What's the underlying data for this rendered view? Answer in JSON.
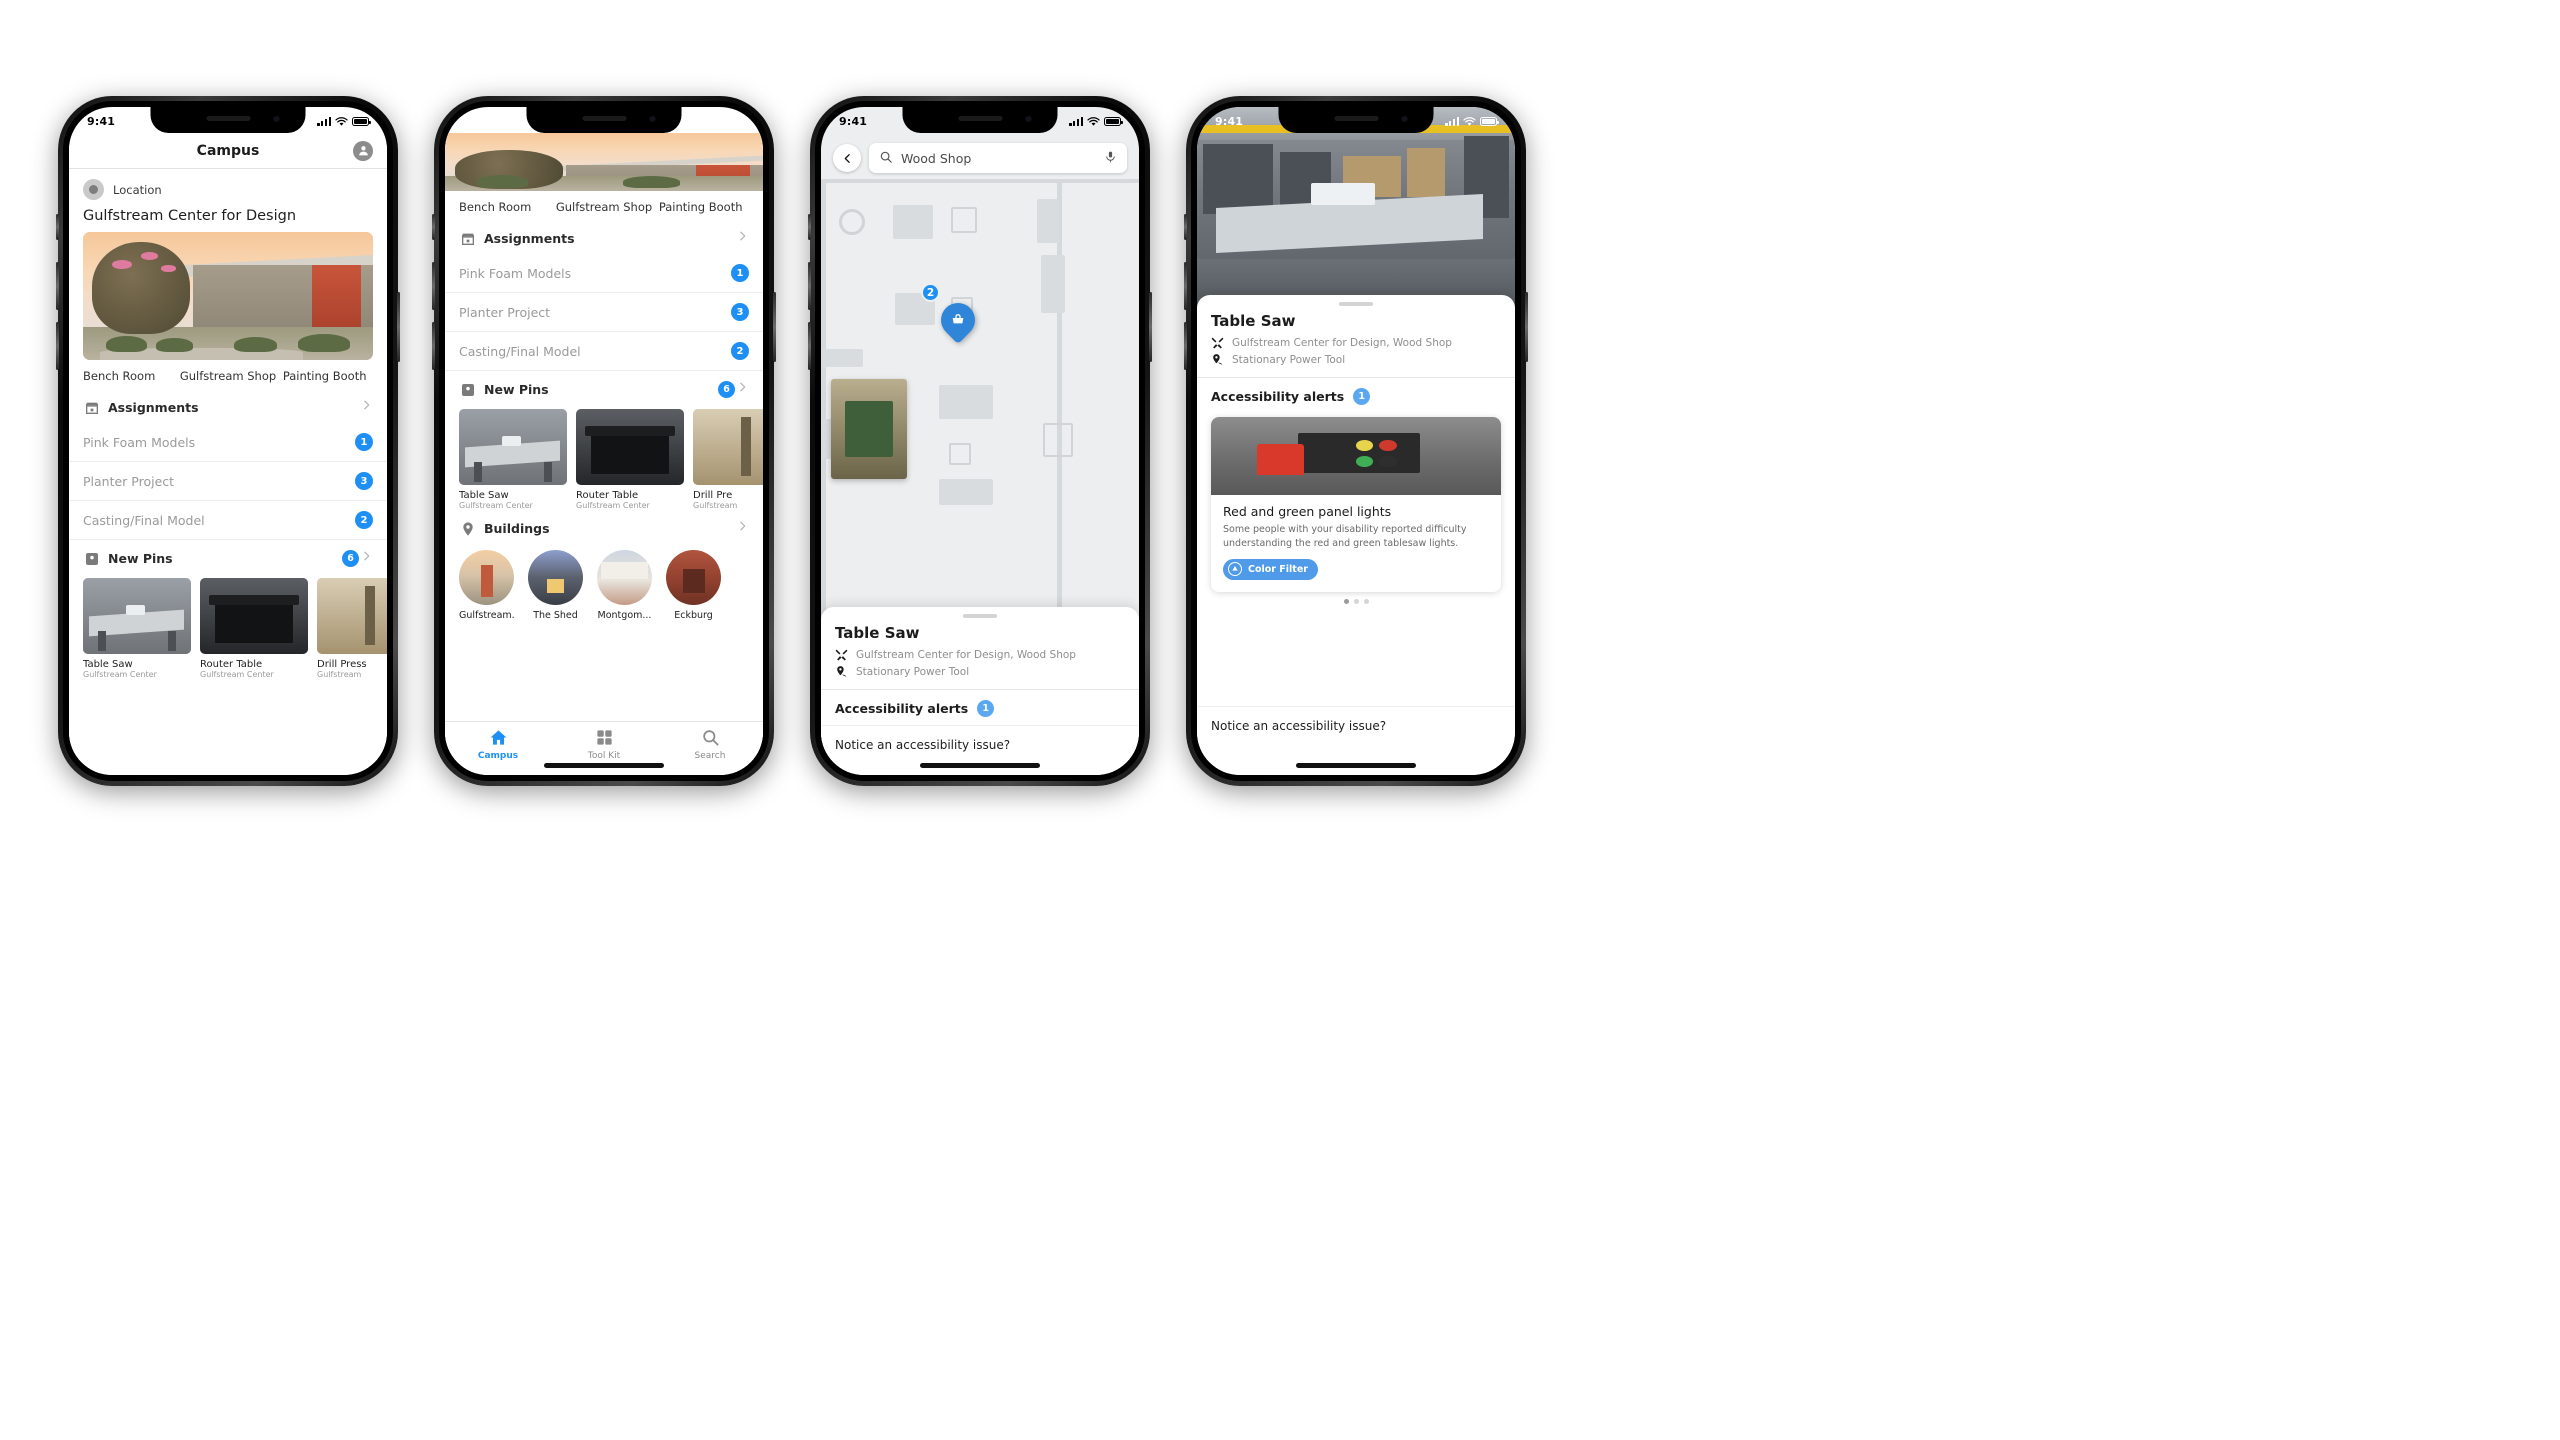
{
  "status_bar": {
    "time": "9:41",
    "signal_icon": "cellular-bars-icon",
    "wifi_icon": "wifi-icon",
    "battery_icon": "battery-icon"
  },
  "phone1": {
    "nav": {
      "title": "Campus",
      "avatar_icon": "account-avatar-icon"
    },
    "location": {
      "icon": "location-dot-icon",
      "label": "Location",
      "title": "Gulfstream Center for Design",
      "hero_alt": "gulfstream-center-exterior"
    },
    "chips": [
      "Bench Room",
      "Gulfstream Shop",
      "Painting Booth"
    ],
    "assignments": {
      "icon": "calendar-icon",
      "title": "Assignments",
      "chevron": "chevron-right-icon",
      "items": [
        {
          "label": "Pink Foam Models",
          "badge": "1"
        },
        {
          "label": "Planter Project",
          "badge": "3"
        },
        {
          "label": "Casting/Final Model",
          "badge": "2"
        }
      ]
    },
    "new_pins": {
      "icon": "pin-square-icon",
      "title": "New Pins",
      "badge": "6",
      "chevron": "chevron-right-icon",
      "items": [
        {
          "caption": "Table Saw",
          "sub": "Gulfstream Center"
        },
        {
          "caption": "Router Table",
          "sub": "Gulfstream Center"
        },
        {
          "caption": "Drill Press",
          "sub": "Gulfstream"
        }
      ]
    }
  },
  "phone2": {
    "chips": [
      "Bench Room",
      "Gulfstream Shop",
      "Painting Booth"
    ],
    "assignments": {
      "icon": "calendar-icon",
      "title": "Assignments",
      "chevron": "chevron-right-icon",
      "items": [
        {
          "label": "Pink Foam Models",
          "badge": "1"
        },
        {
          "label": "Planter Project",
          "badge": "3"
        },
        {
          "label": "Casting/Final Model",
          "badge": "2"
        }
      ]
    },
    "new_pins": {
      "icon": "pin-square-icon",
      "title": "New Pins",
      "badge": "6",
      "chevron": "chevron-right-icon",
      "items": [
        {
          "caption": "Table Saw",
          "sub": "Gulfstream Center"
        },
        {
          "caption": "Router Table",
          "sub": "Gulfstream Center"
        },
        {
          "caption": "Drill Pre",
          "sub": "Gulfstream"
        }
      ]
    },
    "buildings": {
      "icon": "map-pin-icon",
      "title": "Buildings",
      "chevron": "chevron-right-icon",
      "items": [
        {
          "name": "Gulfstream..."
        },
        {
          "name": "The Shed"
        },
        {
          "name": "Montgom..."
        },
        {
          "name": "Eckburg"
        }
      ]
    },
    "tabs": [
      {
        "label": "Campus",
        "icon": "home-icon",
        "active": true
      },
      {
        "label": "Tool Kit",
        "icon": "grid-icon",
        "active": false
      },
      {
        "label": "Search",
        "icon": "search-icon",
        "active": false
      }
    ]
  },
  "phone3": {
    "search": {
      "back_icon": "chevron-left-icon",
      "search_icon": "search-icon",
      "value": "Wood Shop",
      "mic_icon": "microphone-icon"
    },
    "map": {
      "pin_icon": "tool-pin-icon",
      "pin_badge": "2"
    },
    "sheet": {
      "title": "Table Saw",
      "location_icon": "tools-icon",
      "location": "Gulfstream Center for Design, Wood Shop",
      "category_icon": "pin-person-icon",
      "category": "Stationary Power Tool",
      "alerts_label": "Accessibility alerts",
      "alerts_badge": "1",
      "notice": "Notice an accessibility issue?"
    }
  },
  "phone4": {
    "photo_alt": "table-saw-in-wood-shop",
    "sheet": {
      "title": "Table Saw",
      "location_icon": "tools-icon",
      "location": "Gulfstream Center for Design, Wood Shop",
      "category_icon": "pin-person-icon",
      "category": "Stationary Power Tool",
      "alerts_label": "Accessibility alerts",
      "alerts_badge": "1",
      "notice": "Notice an accessibility issue?"
    },
    "alert_card": {
      "image_alt": "red-and-green-panel-lights-photo",
      "title": "Red and green panel lights",
      "description": "Some people with your disability reported difficulty understanding the red and green tablesaw lights.",
      "action": {
        "icon": "color-filter-icon",
        "label": "Color Filter"
      }
    },
    "pager": {
      "count": 3,
      "active": 0
    }
  },
  "colors": {
    "accent": "#1e90f5",
    "badge": "#1e90f5",
    "button": "#4f9bea",
    "muted_text": "#9a9a9a",
    "map_bg": "#eceef0"
  }
}
